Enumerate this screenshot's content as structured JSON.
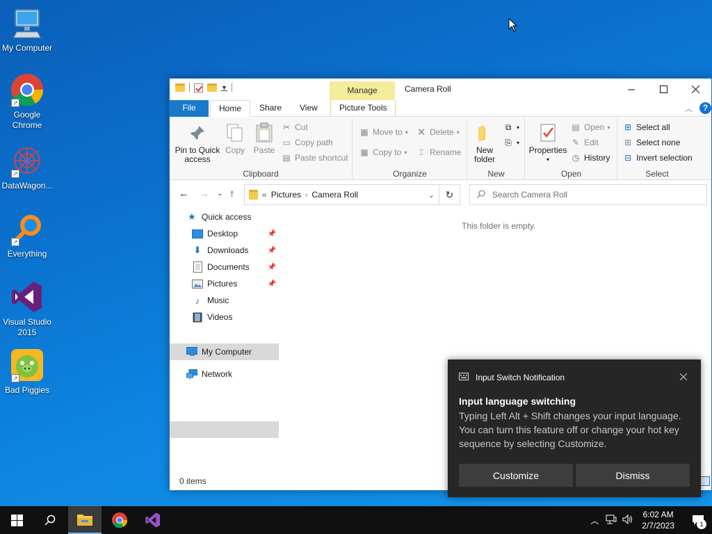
{
  "desktop": {
    "icons": [
      {
        "label": "My Computer",
        "icon": "computer-icon"
      },
      {
        "label": "Google Chrome",
        "icon": "chrome-icon"
      },
      {
        "label": "DataWagon...",
        "icon": "datawagon-icon"
      },
      {
        "label": "Everything",
        "icon": "everything-search-icon"
      },
      {
        "label": "Visual Studio 2015",
        "icon": "visual-studio-icon"
      },
      {
        "label": "Bad Piggies",
        "icon": "bad-piggies-icon"
      }
    ]
  },
  "explorer": {
    "title": "Camera Roll",
    "manage_tab": "Manage",
    "tabs": {
      "file": "File",
      "home": "Home",
      "share": "Share",
      "view": "View",
      "picture_tools": "Picture Tools"
    },
    "ribbon": {
      "clipboard": {
        "label": "Clipboard",
        "pin": "Pin to Quick access",
        "copy": "Copy",
        "paste": "Paste",
        "cut": "Cut",
        "copy_path": "Copy path",
        "paste_shortcut": "Paste shortcut"
      },
      "organize": {
        "label": "Organize",
        "move_to": "Move to",
        "copy_to": "Copy to",
        "delete": "Delete",
        "rename": "Rename"
      },
      "new": {
        "label": "New",
        "new_folder": "New folder"
      },
      "open": {
        "label": "Open",
        "properties": "Properties",
        "open": "Open",
        "edit": "Edit",
        "history": "History"
      },
      "select": {
        "label": "Select",
        "select_all": "Select all",
        "select_none": "Select none",
        "invert": "Invert selection"
      }
    },
    "address": {
      "overflow": "«",
      "crumbs": [
        "Pictures",
        "Camera Roll"
      ],
      "search_placeholder": "Search Camera Roll"
    },
    "nav": {
      "quick_access": "Quick access",
      "items": [
        "Desktop",
        "Downloads",
        "Documents",
        "Pictures",
        "Music",
        "Videos"
      ],
      "my_computer": "My Computer",
      "network": "Network"
    },
    "content": {
      "empty_message": "This folder is empty."
    },
    "status": {
      "item_count": "0 items"
    }
  },
  "toast": {
    "app": "Input Switch Notification",
    "title": "Input language switching",
    "body": "Typing Left Alt + Shift changes your input language. You can turn this feature off or change your hot key sequence by selecting Customize.",
    "customize": "Customize",
    "dismiss": "Dismiss"
  },
  "taskbar": {
    "time": "6:02 AM",
    "date": "2/7/2023",
    "notification_count": "1"
  },
  "colors": {
    "accent": "#1979ca",
    "manage_tab": "#f5ec9a",
    "toast_bg": "#262626",
    "taskbar_bg": "#101010"
  }
}
